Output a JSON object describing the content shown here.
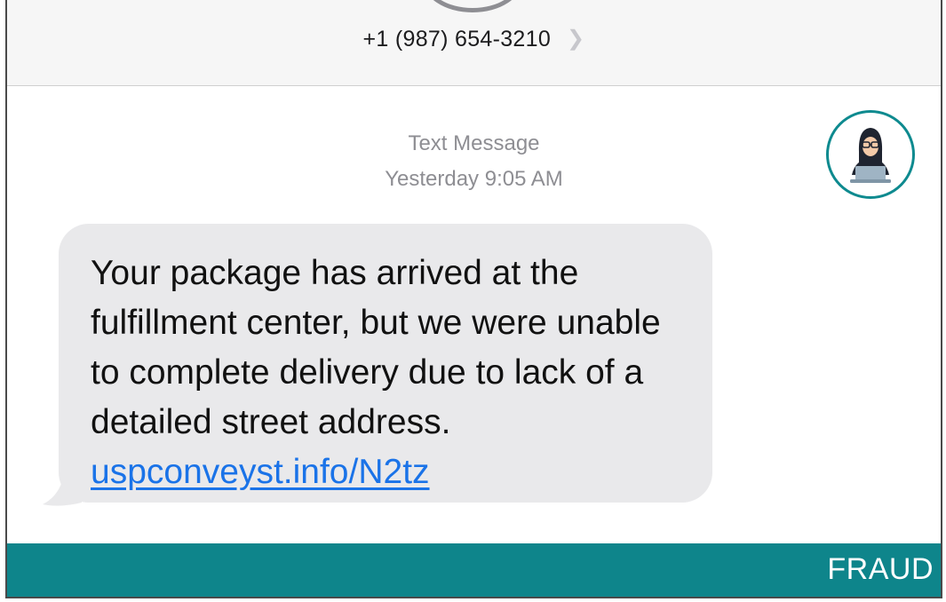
{
  "header": {
    "contact_number": "+1 (987) 654-3210",
    "chevron_icon": "chevron-right-icon"
  },
  "conversation": {
    "message_type": "Text Message",
    "timestamp": "Yesterday 9:05 AM",
    "message_text": "Your package has arrived at the fulfillment center, but we were unable to complete delivery due to lack of a detailed street address.",
    "message_link": "uspconveyst.info/N2tz",
    "bubble_color": "#e9e9eb",
    "link_color": "#1a73e8"
  },
  "badge": {
    "icon": "hacker-icon",
    "accent_color": "#0e8a8f"
  },
  "banner": {
    "label": "FRAUD",
    "color": "#0e858b"
  }
}
